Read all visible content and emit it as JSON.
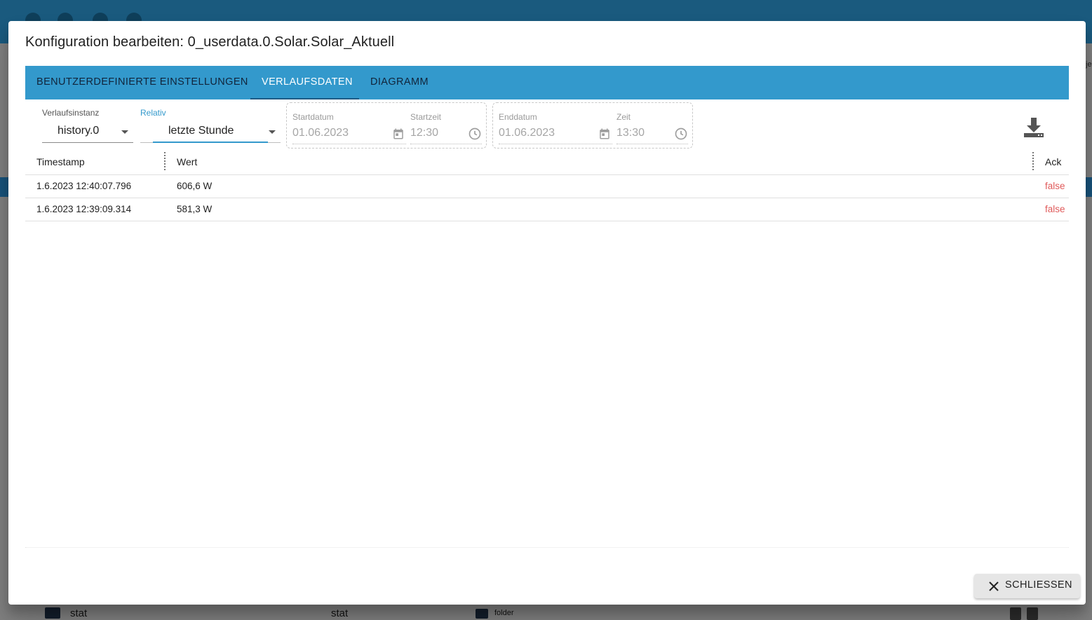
{
  "dialog": {
    "title": "Konfiguration bearbeiten: 0_userdata.0.Solar.Solar_Aktuell",
    "close_label": "SCHLIESSEN"
  },
  "tabs": [
    {
      "label": "BENUTZERDEFINIERTE EINSTELLUNGEN",
      "active": false
    },
    {
      "label": "VERLAUFSDATEN",
      "active": true
    },
    {
      "label": "DIAGRAMM",
      "active": false
    }
  ],
  "filters": {
    "instance": {
      "label": "Verlaufsinstanz",
      "value": "history.0"
    },
    "relative": {
      "label": "Relativ",
      "value": "letzte Stunde"
    },
    "start": {
      "date_label": "Startdatum",
      "date_value": "01.06.2023",
      "time_label": "Startzeit",
      "time_value": "12:30"
    },
    "end": {
      "date_label": "Enddatum",
      "date_value": "01.06.2023",
      "time_label": "Zeit",
      "time_value": "13:30"
    }
  },
  "table": {
    "columns": [
      "Timestamp",
      "Wert",
      "Ack"
    ],
    "rows": [
      {
        "timestamp": "1.6.2023 12:40:07.796",
        "value": "606,6 W",
        "ack": "false"
      },
      {
        "timestamp": "1.6.2023 12:39:09.314",
        "value": "581,3 W",
        "ack": "false"
      }
    ]
  },
  "background": {
    "corner_text": "je",
    "row": {
      "name": "stat",
      "id": "stat",
      "type": "folder"
    }
  },
  "colors": {
    "tabbar": "#3399cc",
    "tab_indicator": "#1d5a85",
    "ack_false": "#e05a5a",
    "app_header": "#1a5a7e"
  },
  "icons": [
    "download-icon",
    "calendar-icon",
    "clock-icon",
    "close-icon",
    "folder-icon",
    "edit-icon",
    "delete-icon",
    "caret-down-icon"
  ]
}
